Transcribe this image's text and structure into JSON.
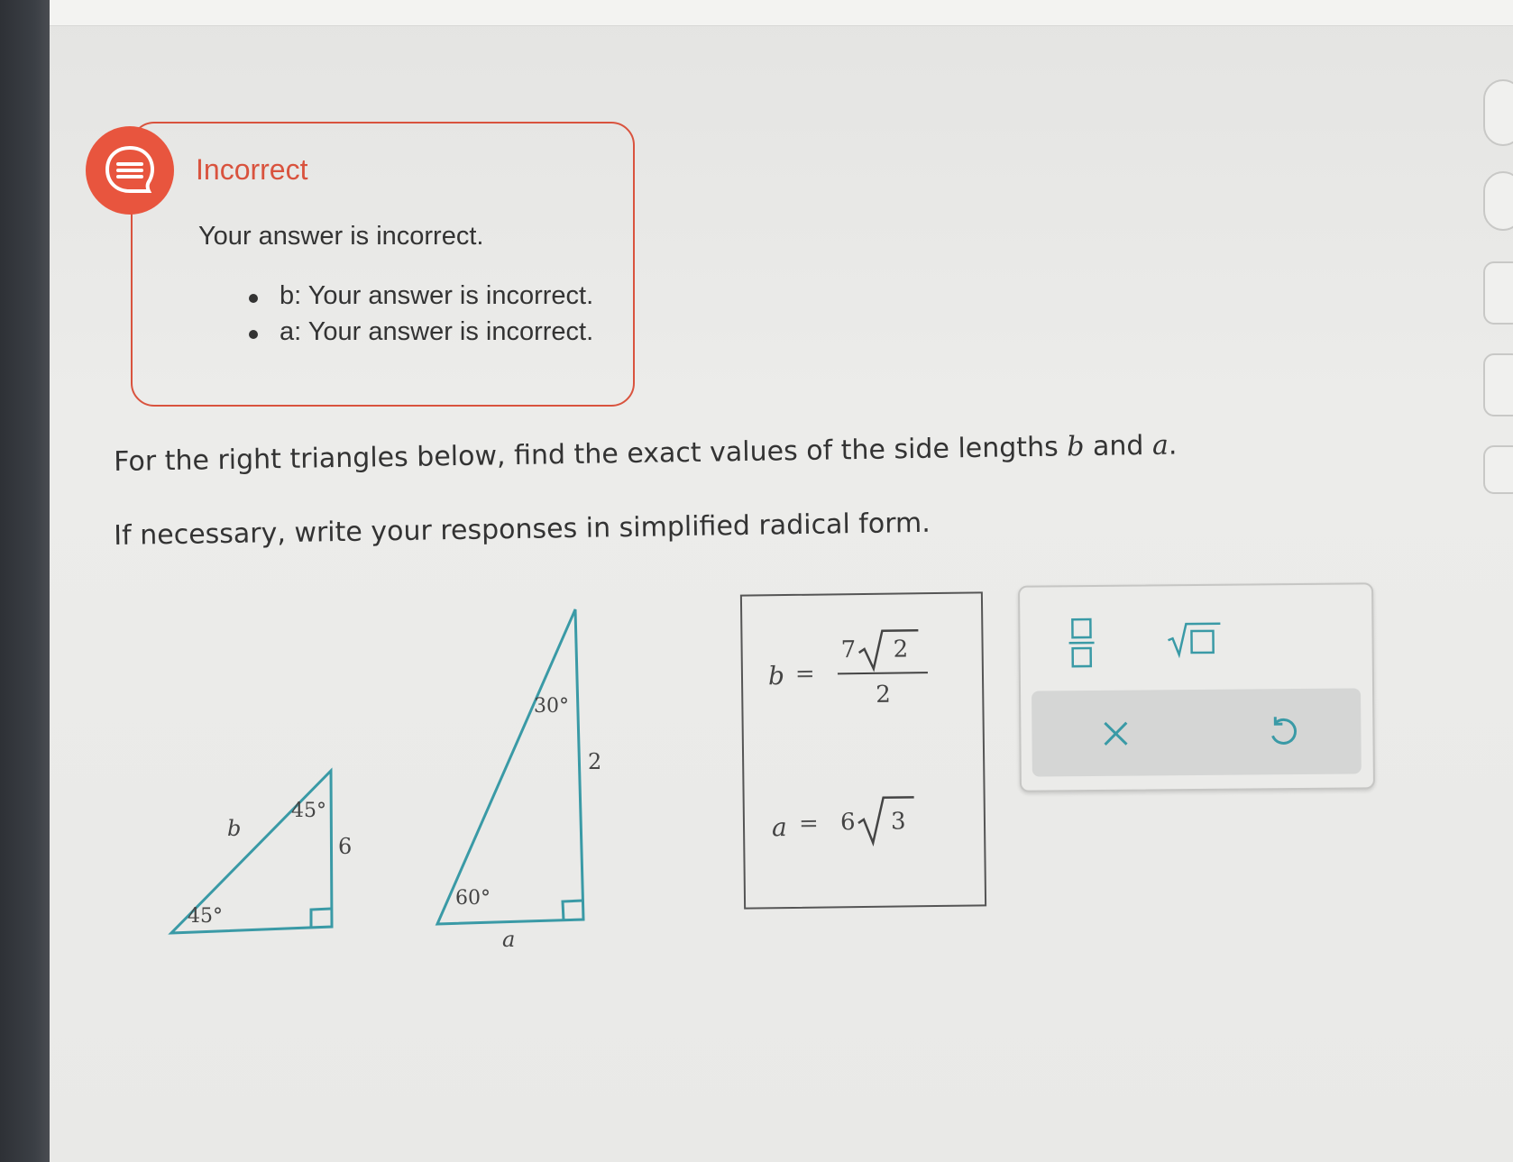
{
  "feedback": {
    "title": "Incorrect",
    "message": "Your answer is incorrect.",
    "items": [
      "b: Your answer is incorrect.",
      "a: Your answer is incorrect."
    ]
  },
  "question": {
    "line1_prefix": "For the right triangles below, find the exact values of the side lengths ",
    "var_b": "b",
    "and": " and ",
    "var_a": "a",
    "period": ".",
    "line2": "If necessary, write your responses in simplified radical form."
  },
  "triangle1": {
    "hyp_label": "b",
    "side_label": "6",
    "angle_top": "45°",
    "angle_bottom": "45°"
  },
  "triangle2": {
    "side_label": "2",
    "base_label": "a",
    "angle_top": "30°",
    "angle_bottom": "60°"
  },
  "answers": {
    "b_label": "b",
    "a_label": "a",
    "equals": "=",
    "b_coef": "7",
    "b_radicand": "2",
    "b_denominator": "2",
    "a_coef": "6",
    "a_radicand": "3"
  },
  "palette": {
    "tools": [
      "fraction-icon",
      "sqrt-icon"
    ],
    "actions": [
      "clear-icon",
      "undo-icon"
    ]
  },
  "colors": {
    "accent": "#e8553e",
    "triangle": "#3a9aa6"
  }
}
